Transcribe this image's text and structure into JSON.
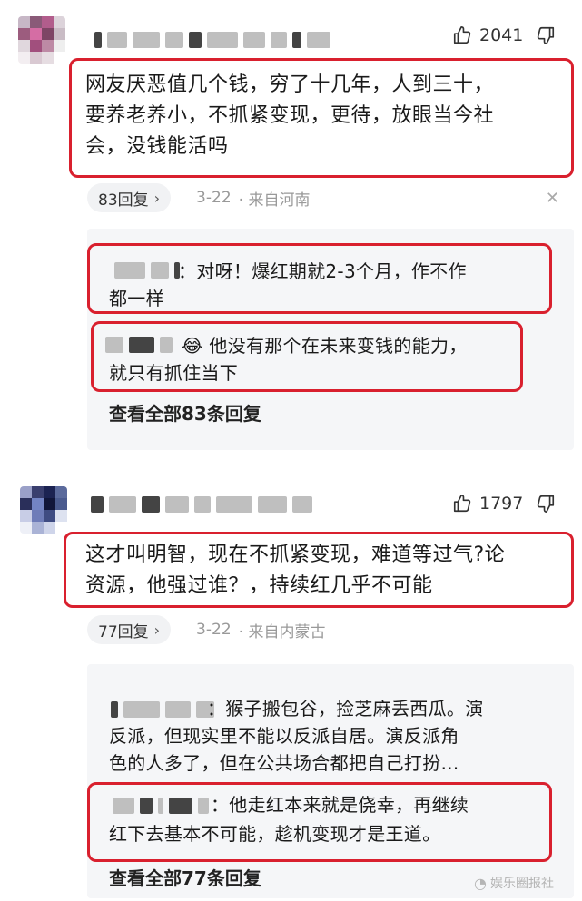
{
  "comment1": {
    "likes": "2041",
    "text": "网友厌恶值几个钱，穷了十几年，人到三十，要养老养小，不抓紧变现，更待，放眼当今社会，没钱能活吗",
    "line1": "网友厌恶值几个钱，穷了十几年，人到三十，",
    "line2": "要养老养小，不抓紧变现，更待，放眼当今社",
    "line3": "会，没钱能活吗",
    "replies_label": "83回复",
    "date": "3-22",
    "location": "· 来自河南",
    "replies": [
      {
        "line1": "：对呀！爆红期就2-3个月，作不作",
        "line2": "都一样"
      },
      {
        "emoji": "😂",
        "line1": "他没有那个在未来变钱的能力，",
        "line2": "就只有抓住当下"
      }
    ],
    "view_all": "查看全部83条回复"
  },
  "comment2": {
    "likes": "1797",
    "line1": "这才叫明智，现在不抓紧变现，难道等过气?论",
    "line2": "资源，他强过谁？，持续红几乎不可能",
    "replies_label": "77回复",
    "date": "3-22",
    "location": "· 来自内蒙古",
    "replies": [
      {
        "line1": "：猴子搬包谷，捡芝麻丢西瓜。演",
        "line2": "反派，但现实里不能以反派自居。演反派角",
        "line3": "色的人多了，但在公共场合都把自己打扮…"
      },
      {
        "line1": "：他走红本来就是侥幸，再继续",
        "line2": "红下去基本不可能，趁机变现才是王道。"
      }
    ],
    "view_all": "查看全部77条回复"
  },
  "watermark": "娱乐圈报社",
  "icons": {
    "like": "thumbs-up-icon",
    "dislike": "thumbs-down-icon",
    "close": "close-icon",
    "chevron": "chevron-right-icon"
  },
  "colors": {
    "highlight_border": "#d9202e",
    "reply_bg": "#f5f6f8",
    "meta_text": "#999999"
  }
}
